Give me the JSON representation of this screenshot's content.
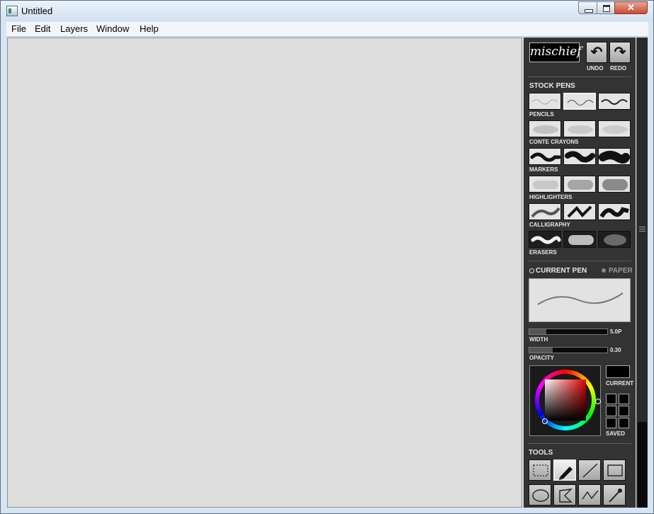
{
  "window": {
    "title": "Untitled"
  },
  "menu": [
    "File",
    "Edit",
    "Layers",
    "Window",
    "Help"
  ],
  "panel": {
    "logo": "mischief",
    "undo_label": "UNDO",
    "redo_label": "REDO",
    "stock_pens_title": "STOCK PENS",
    "pen_groups": [
      "PENCILS",
      "CONTE CRAYONS",
      "MARKERS",
      "HIGHLIGHTERS",
      "CALLIGRAPHY",
      "ERASERS"
    ],
    "current_pen_label": "CURRENT PEN",
    "paper_label": "PAPER",
    "width_label": "WIDTH",
    "width_value": "5.0P",
    "width_fraction": 0.22,
    "opacity_label": "OPACITY",
    "opacity_value": "0.30",
    "opacity_fraction": 0.3,
    "current_color_label": "CURRENT",
    "saved_label": "SAVED",
    "tools_title": "TOOLS",
    "tools": [
      "rect-select-icon",
      "pen-tool-icon",
      "line-tool-icon",
      "rectangle-tool-icon",
      "ellipse-tool-icon",
      "lasso-tool-icon",
      "polyline-tool-icon",
      "eyedropper-tool-icon"
    ]
  },
  "colors": {
    "panel": "#333333",
    "canvas": "#dedede",
    "current_color": "#000000"
  }
}
